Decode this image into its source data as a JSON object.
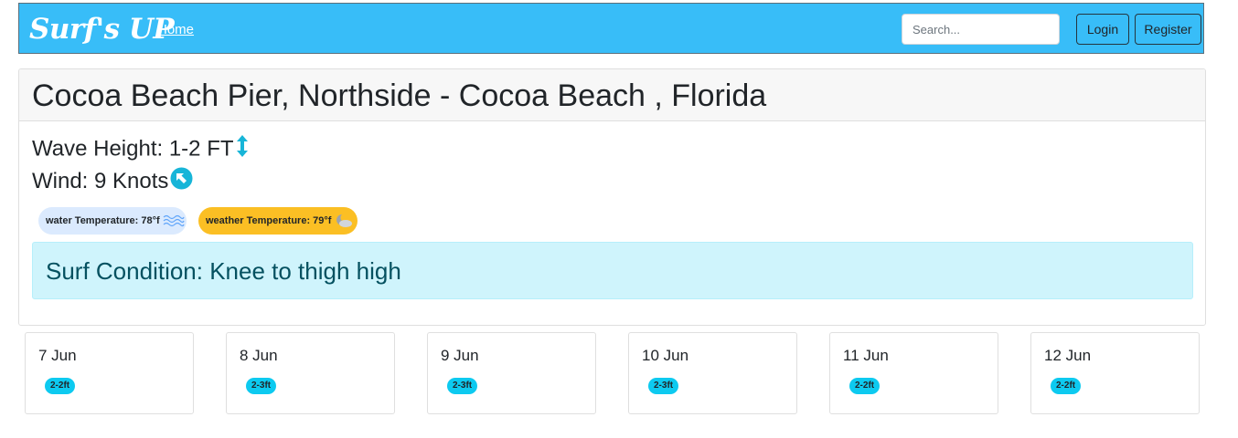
{
  "navbar": {
    "brand": "Surf's UP",
    "home_link": "Home",
    "search_placeholder": "Search...",
    "login_label": "Login",
    "register_label": "Register",
    "background_color": "#38bdf8"
  },
  "spot": {
    "title": "Cocoa Beach Pier, Northside - Cocoa Beach , Florida",
    "wave_height": "Wave Height: 1-2 FT",
    "wind": "Wind: 9 Knots",
    "water_temperature": "water Temperature: 78°f",
    "weather_temperature": "weather Temperature: 79°f",
    "surf_condition": "Surf Condition: Knee to thigh high",
    "icons": {
      "wave_height": "vertical-arrows-icon",
      "wind": "wind-direction-arrow-icon",
      "water": "waves-icon",
      "weather": "partly-cloudy-night-icon"
    }
  },
  "forecast": [
    {
      "date": "7 Jun",
      "wave": "2-2ft"
    },
    {
      "date": "8 Jun",
      "wave": "2-3ft"
    },
    {
      "date": "9 Jun",
      "wave": "2-3ft"
    },
    {
      "date": "10 Jun",
      "wave": "2-3ft"
    },
    {
      "date": "11 Jun",
      "wave": "2-2ft"
    },
    {
      "date": "12 Jun",
      "wave": "2-2ft"
    }
  ]
}
